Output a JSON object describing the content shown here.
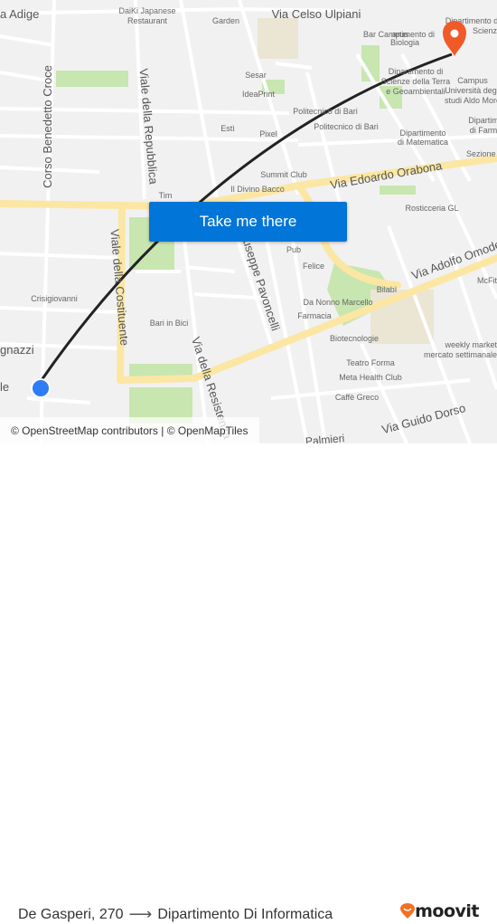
{
  "map": {
    "labels": [
      "a Adige",
      "DaiKi Japanese",
      "Restaurant",
      "Garden",
      "Via Celso Ulpiani",
      "Bar Campus",
      "artimento di",
      "Biologia",
      "Dipartimento di",
      "Scienze Fo",
      "Sesar",
      "IdeaPrint",
      "Dipartimento di",
      "Scienze della Terra",
      "e Geoambientali",
      "Campus",
      "Università degli",
      "studi Aldo Moro",
      "Politecnico di Bari",
      "Politecnico di Bari",
      "Estì",
      "Pixel",
      "Dipartimento",
      "di Matematica",
      "Dipartim",
      "di Farm",
      "Sezione",
      "Summit Club",
      "Via Edoardo Orabona",
      "Il Divino Bacco",
      "Tim",
      "Rosticceria GL",
      "Pub",
      "Felice",
      "Via Adolfo Omodeo",
      "McFit",
      "Bilabì",
      "Crisigiovanni",
      "Da Nonno Marcello",
      "Farmacia",
      "Bari in Bici",
      "Biotecnologie",
      "weekly market",
      "mercato settimanale",
      "gnazzi",
      "le",
      "Teatro Forma",
      "Meta Health Club",
      "Caffè Greco",
      "Via Guido Dorso",
      "Palmieri",
      "Corso Benedetto Croce",
      "Viale della Repubblica",
      "Viale della Costituente",
      "Giuseppe Pavoncelli",
      "Via della Resistenza"
    ],
    "attribution": {
      "osm": "© OpenStreetMap contributors",
      "sep": " | ",
      "omt": "© OpenMapTiles"
    },
    "colors": {
      "background": "#f1f1f1",
      "major_road": "#fbe7a3",
      "park": "#c8e6b0",
      "route_line": "#222222",
      "origin": "#2e7cf6",
      "destination": "#f05a28"
    }
  },
  "cta": {
    "label": "Take me there"
  },
  "footer": {
    "origin": "De Gasperi, 270",
    "arrow_icon": "arrow-right-icon",
    "destination": "Dipartimento Di Informatica",
    "brand": "moovit"
  }
}
